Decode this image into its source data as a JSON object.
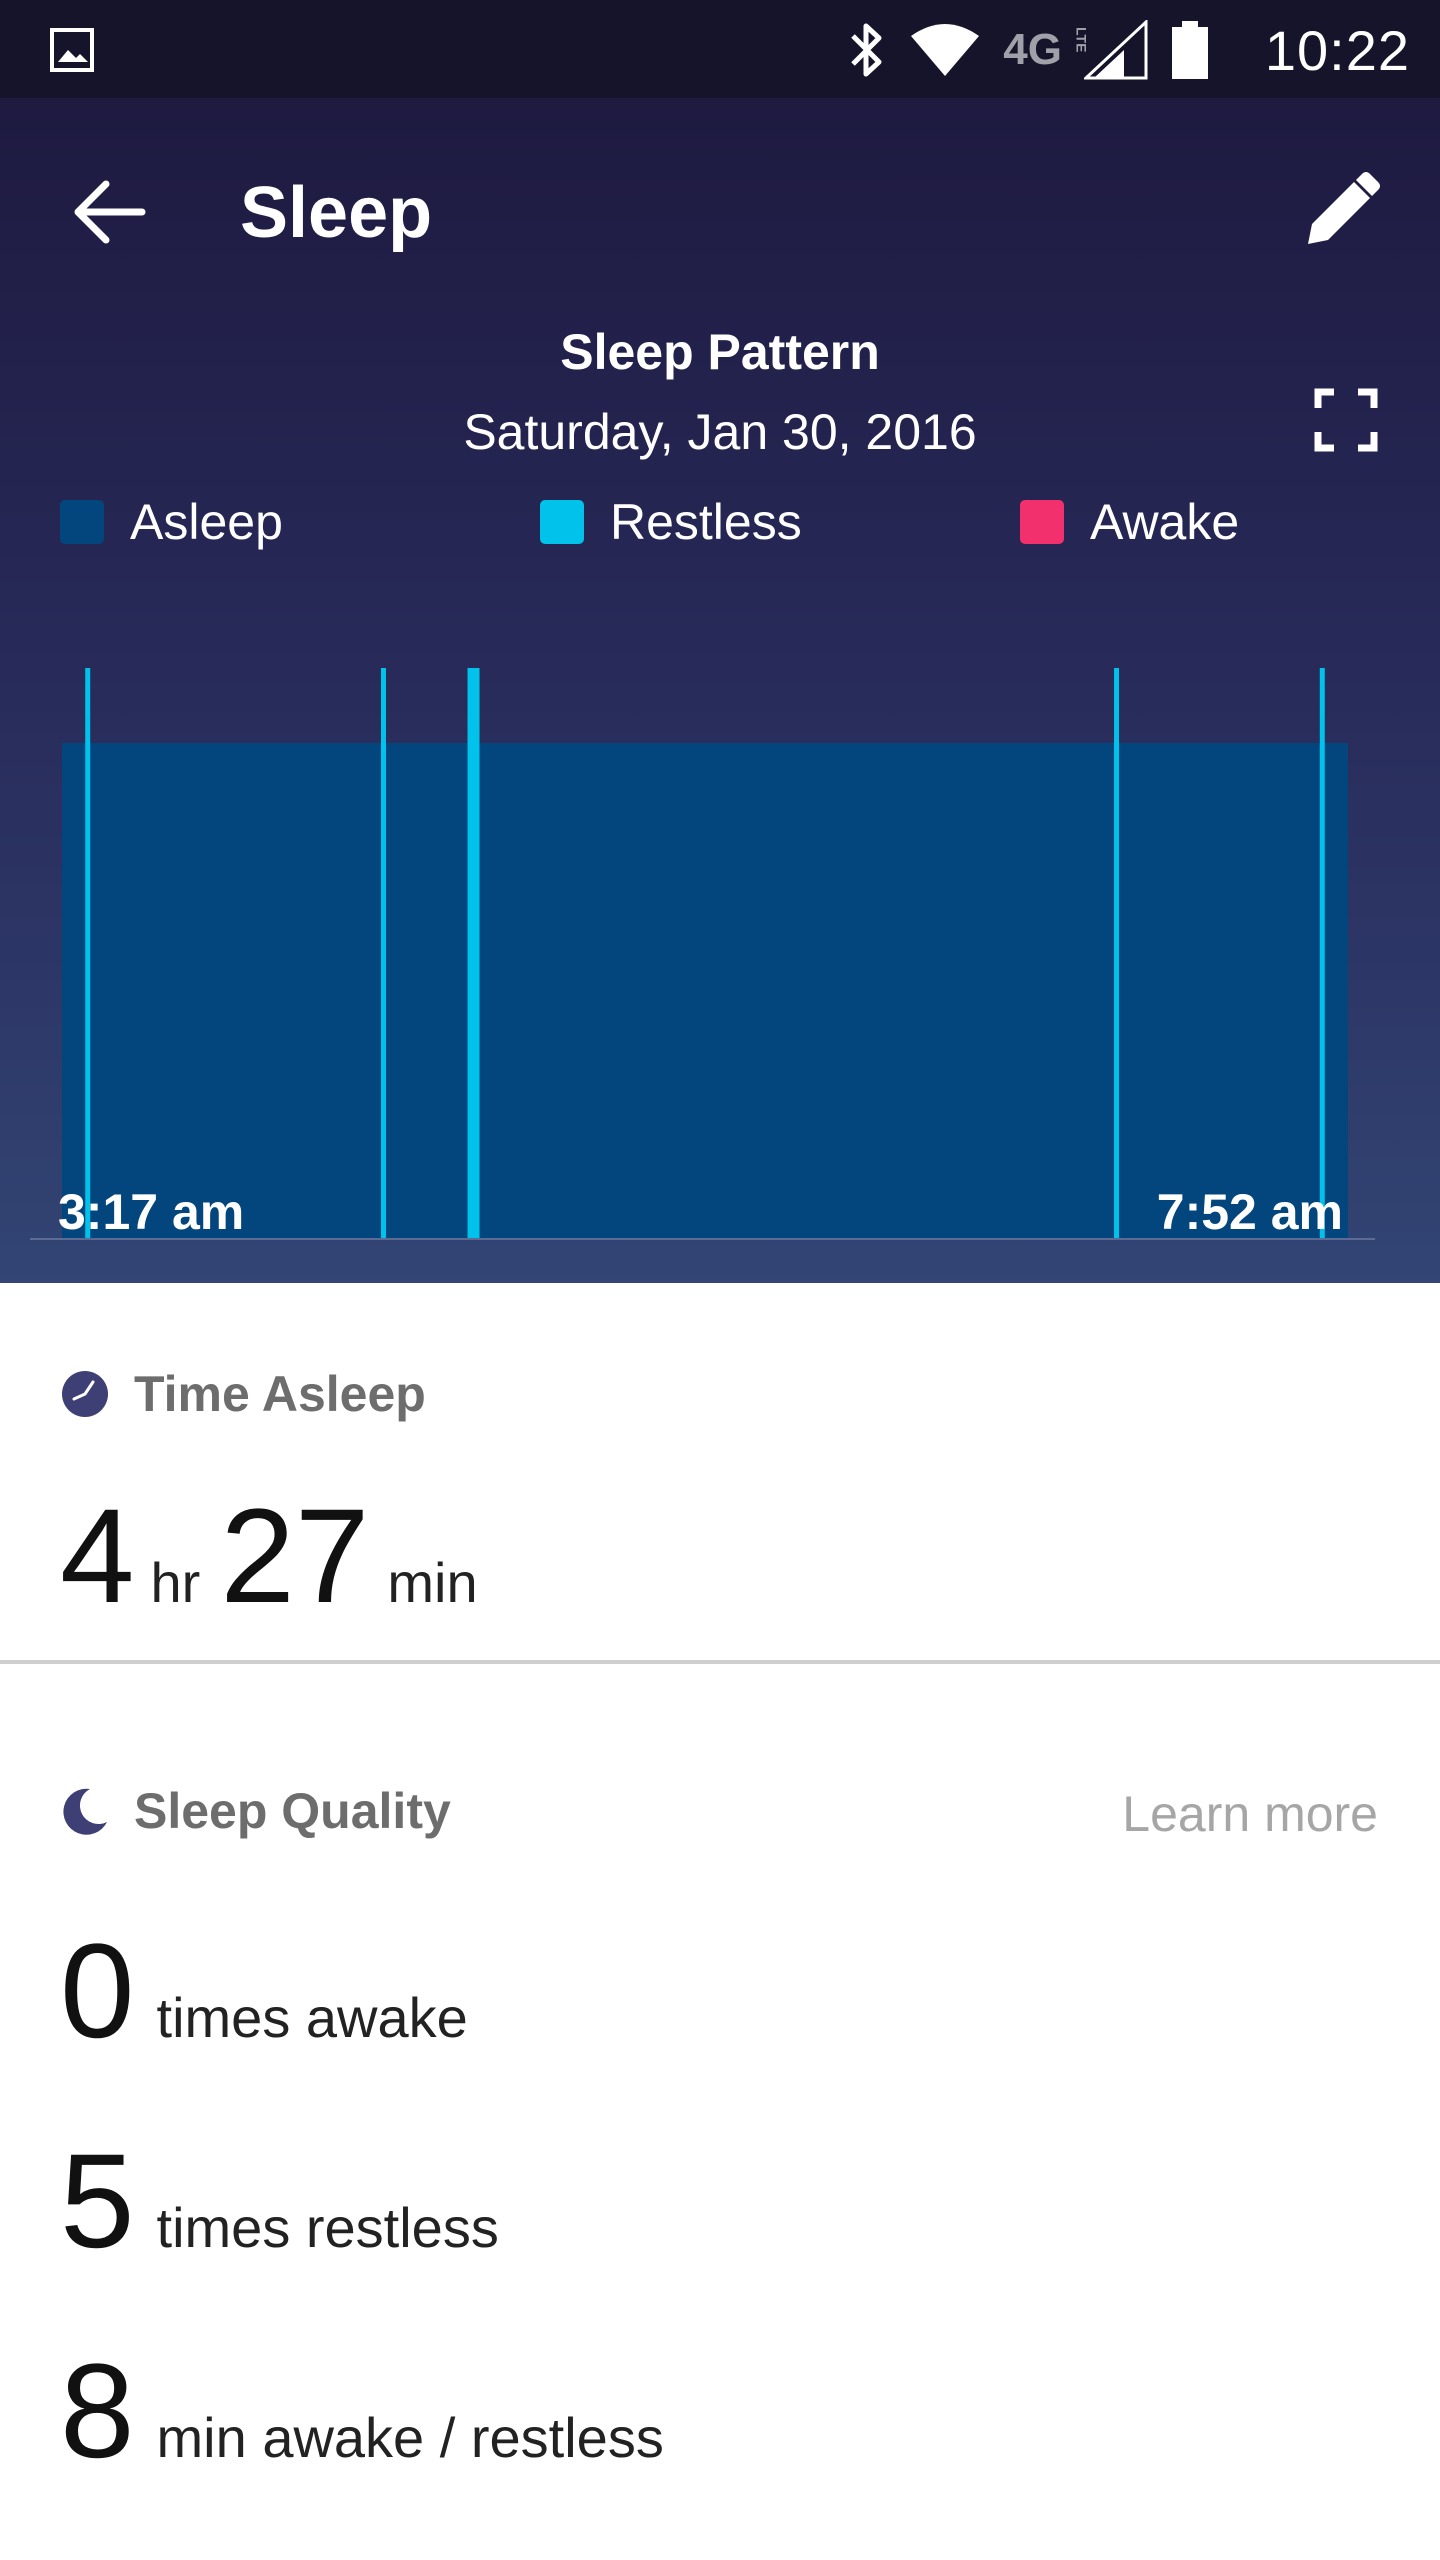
{
  "status_bar": {
    "time": "10:22",
    "network": "4G",
    "network_sub": "LTE",
    "icons": [
      "image-icon",
      "bluetooth-icon",
      "wifi-icon",
      "signal-icon",
      "battery-icon"
    ]
  },
  "header": {
    "title": "Sleep"
  },
  "pattern": {
    "title": "Sleep Pattern",
    "date": "Saturday, Jan 30, 2016",
    "legend": [
      {
        "label": "Asleep",
        "color": "#03457d"
      },
      {
        "label": "Restless",
        "color": "#00c2ea"
      },
      {
        "label": "Awake",
        "color": "#f3306e"
      }
    ],
    "start_time": "3:17 am",
    "end_time": "7:52 am"
  },
  "chart_data": {
    "type": "bar",
    "segments": [
      {
        "state": "asleep",
        "start": 0.0,
        "end": 1.0
      }
    ],
    "restless_marks": [
      0.02,
      0.25,
      0.32,
      0.82,
      0.98
    ],
    "colors": {
      "asleep": "#03457d",
      "restless": "#00c2ea",
      "awake": "#f3306e"
    }
  },
  "time_asleep": {
    "heading": "Time Asleep",
    "hours": "4",
    "hours_unit": "hr",
    "minutes": "27",
    "minutes_unit": "min"
  },
  "sleep_quality": {
    "heading": "Sleep Quality",
    "learn_more": "Learn more",
    "stats": [
      {
        "value": "0",
        "label": "times awake"
      },
      {
        "value": "5",
        "label": "times restless"
      },
      {
        "value": "8",
        "label": "min awake / restless"
      }
    ]
  },
  "colors": {
    "header_bg": "#1e1a40",
    "status_bg": "#15142a",
    "icon_accent": "#3e3f74"
  }
}
